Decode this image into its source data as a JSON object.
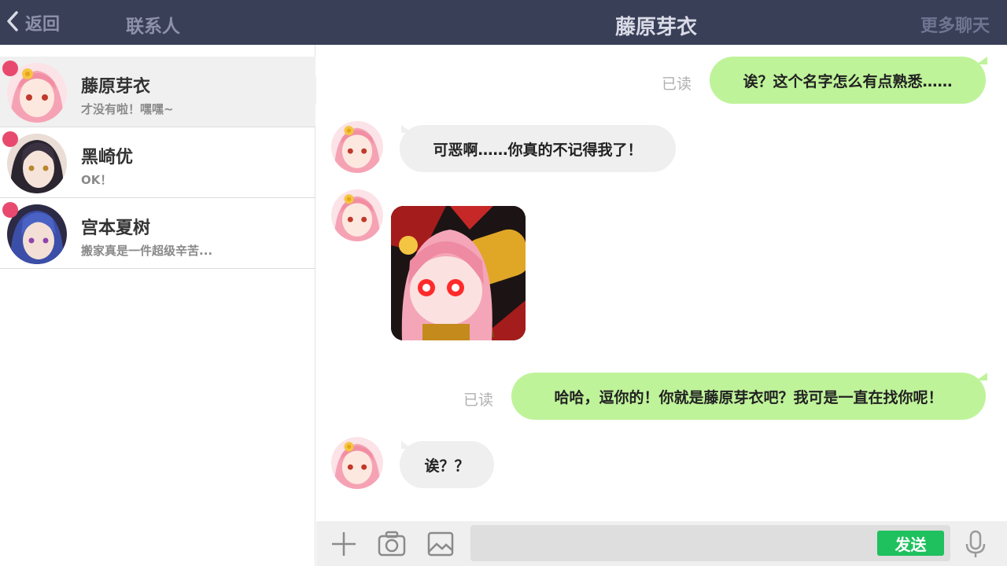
{
  "header": {
    "back_label": "返回",
    "contacts_title": "联系人",
    "chat_title": "藤原芽衣",
    "more_chats": "更多聊天"
  },
  "contacts": [
    {
      "name": "藤原芽衣",
      "preview": "才没有啦！嘿嘿~",
      "unread": true,
      "active": true
    },
    {
      "name": "黑崎优",
      "preview": "OK！",
      "unread": true,
      "active": false
    },
    {
      "name": "宫本夏树",
      "preview": "搬家真是一件超级辛苦...",
      "unread": true,
      "active": false
    }
  ],
  "messages": [
    {
      "from": "me",
      "text": "诶？这个名字怎么有点熟悉……",
      "status": "已读"
    },
    {
      "from": "other",
      "text": "可恶啊……你真的不记得我了！"
    },
    {
      "from": "other",
      "type": "sticker"
    },
    {
      "from": "me",
      "text": "哈哈，逗你的！你就是藤原芽衣吧？我可是一直在找你呢！",
      "status": "已读"
    },
    {
      "from": "other",
      "text": "诶？？"
    }
  ],
  "input": {
    "value": "",
    "placeholder": "",
    "send_label": "发送"
  },
  "colors": {
    "topbar": "#3a3f58",
    "outgoing_bubble": "#bff39a",
    "incoming_bubble": "#efefef",
    "unread_dot": "#e84a6f",
    "send_button": "#1fc05e"
  },
  "icons": [
    "back-chevron-icon",
    "plus-icon",
    "camera-icon",
    "image-icon",
    "microphone-icon"
  ]
}
